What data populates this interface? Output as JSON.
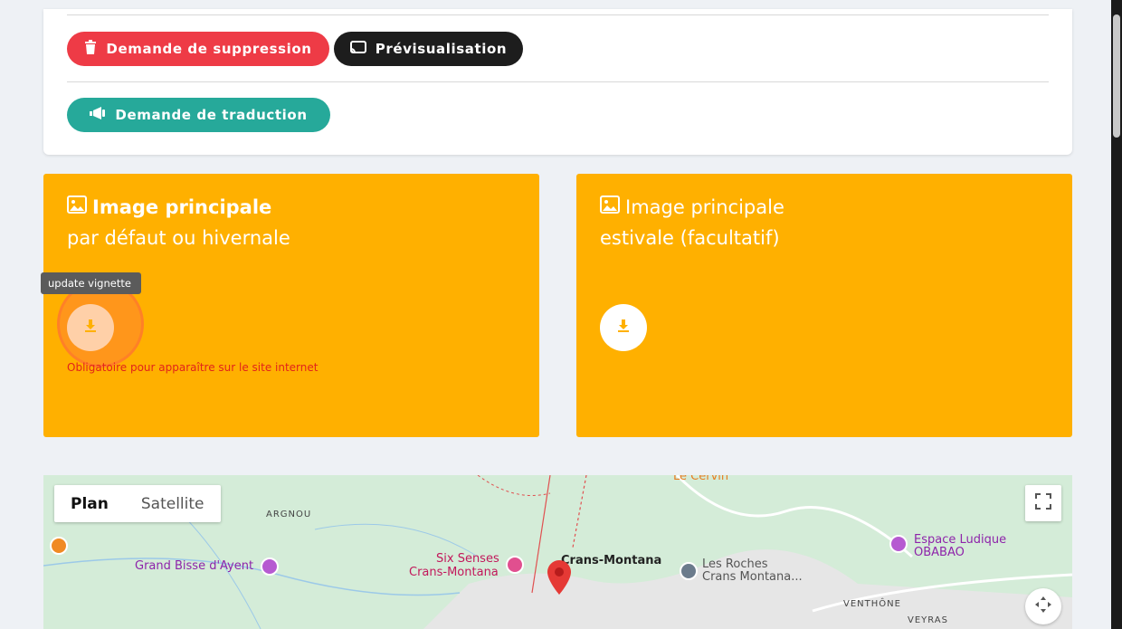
{
  "actions": {
    "delete_label": "Demande de suppression",
    "preview_label": "Prévisualisation",
    "translate_label": "Demande de traduction"
  },
  "main_image": {
    "title": "Image principale",
    "subtitle": "par défaut ou hivernale",
    "tooltip": "update vignette",
    "required_note": "Obligatoire pour apparaître sur le site internet"
  },
  "summer_image": {
    "title": "Image principale",
    "subtitle": "estivale (facultatif)"
  },
  "map": {
    "plan_label": "Plan",
    "satellite_label": "Satellite",
    "places": {
      "argnou": "ARGNOU",
      "grand_bisse": "Grand Bisse d'Ayent",
      "six_senses_1": "Six Senses",
      "six_senses_2": "Crans-Montana",
      "crans_montana": "Crans-Montana",
      "les_roches_1": "Les Roches",
      "les_roches_2": "Crans Montana...",
      "espace_1": "Espace Ludique",
      "espace_2": "OBABAO",
      "venthone": "VENTHÔNE",
      "veyras": "VEYRAS",
      "le_cervin": "Le Cervin"
    }
  },
  "colors": {
    "delete": "#ee3b46",
    "preview": "#1d1d1d",
    "translate": "#26a99a",
    "image_card": "#ffb000",
    "required_text": "#e2231a"
  }
}
